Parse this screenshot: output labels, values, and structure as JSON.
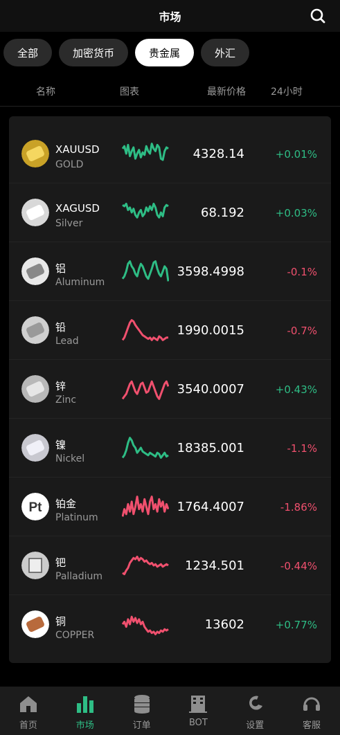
{
  "header": {
    "title": "市场"
  },
  "tabs": [
    {
      "label": "全部",
      "active": false
    },
    {
      "label": "加密货币",
      "active": false
    },
    {
      "label": "贵金属",
      "active": true
    },
    {
      "label": "外汇",
      "active": false
    }
  ],
  "columns": {
    "name": "名称",
    "chart": "图表",
    "price": "最新价格",
    "change": "24小时"
  },
  "colors": {
    "up": "#2ebd85",
    "down": "#f0506e",
    "accent": "#2ebd85"
  },
  "rows": [
    {
      "symbol": "XAUUSD",
      "sub": "GOLD",
      "price": "4328.14",
      "change": "+0.01%",
      "dir": "up",
      "icon": "gold-bar-icon",
      "spark": [
        0.7,
        0.8,
        0.5,
        0.85,
        0.4,
        0.6,
        0.75,
        0.3,
        0.5,
        0.65,
        0.35,
        0.55,
        0.45,
        0.8,
        0.6,
        0.5,
        0.9,
        0.7,
        0.6,
        0.85,
        0.75,
        0.3,
        0.25,
        0.6,
        0.75,
        0.7
      ]
    },
    {
      "symbol": "XAGUSD",
      "sub": "Silver",
      "price": "68.192",
      "change": "+0.03%",
      "dir": "up",
      "icon": "silver-bar-icon",
      "spark": [
        0.8,
        0.75,
        0.85,
        0.6,
        0.7,
        0.5,
        0.65,
        0.4,
        0.3,
        0.5,
        0.6,
        0.35,
        0.45,
        0.7,
        0.55,
        0.75,
        0.6,
        0.85,
        0.7,
        0.4,
        0.3,
        0.5,
        0.35,
        0.7,
        0.8,
        0.75
      ]
    },
    {
      "symbol": "铝",
      "sub": "Aluminum",
      "price": "3598.4998",
      "change": "-0.1%",
      "dir": "up",
      "icon": "aluminum-icon",
      "spark": [
        0.2,
        0.3,
        0.5,
        0.8,
        0.9,
        0.7,
        0.6,
        0.4,
        0.3,
        0.6,
        0.8,
        0.7,
        0.5,
        0.3,
        0.2,
        0.4,
        0.6,
        0.85,
        0.9,
        0.6,
        0.4,
        0.3,
        0.5,
        0.7,
        0.6,
        0.1
      ]
    },
    {
      "symbol": "铅",
      "sub": "Lead",
      "price": "1990.0015",
      "change": "-0.7%",
      "dir": "down",
      "icon": "lead-icon",
      "spark": [
        0.1,
        0.2,
        0.4,
        0.6,
        0.8,
        0.9,
        0.85,
        0.7,
        0.6,
        0.5,
        0.4,
        0.3,
        0.25,
        0.2,
        0.15,
        0.2,
        0.1,
        0.2,
        0.15,
        0.1,
        0.25,
        0.2,
        0.1,
        0.15,
        0.2,
        0.2
      ]
    },
    {
      "symbol": "锌",
      "sub": "Zinc",
      "price": "3540.0007",
      "change": "+0.43%",
      "dir": "down",
      "icon": "zinc-icon",
      "spark": [
        0.1,
        0.2,
        0.3,
        0.5,
        0.7,
        0.8,
        0.6,
        0.4,
        0.3,
        0.5,
        0.7,
        0.75,
        0.55,
        0.35,
        0.4,
        0.6,
        0.8,
        0.6,
        0.4,
        0.2,
        0.1,
        0.3,
        0.5,
        0.7,
        0.8,
        0.6
      ]
    },
    {
      "symbol": "镍",
      "sub": "Nickel",
      "price": "18385.001",
      "change": "-1.1%",
      "dir": "up",
      "icon": "nickel-icon",
      "spark": [
        0.1,
        0.2,
        0.4,
        0.7,
        0.9,
        0.8,
        0.6,
        0.5,
        0.3,
        0.4,
        0.5,
        0.35,
        0.3,
        0.25,
        0.2,
        0.3,
        0.25,
        0.2,
        0.15,
        0.3,
        0.25,
        0.1,
        0.2,
        0.3,
        0.15,
        0.2
      ]
    },
    {
      "symbol": "铂金",
      "sub": "Platinum",
      "price": "1764.4007",
      "change": "-1.86%",
      "dir": "down",
      "icon": "platinum-pt-icon",
      "spark": [
        0.1,
        0.4,
        0.2,
        0.6,
        0.3,
        0.7,
        0.2,
        0.5,
        0.9,
        0.4,
        0.6,
        0.3,
        0.8,
        0.5,
        0.2,
        0.7,
        0.9,
        0.4,
        0.6,
        0.3,
        0.8,
        0.5,
        0.7,
        0.3,
        0.6,
        0.4
      ]
    },
    {
      "symbol": "钯",
      "sub": "Palladium",
      "price": "1234.501",
      "change": "-0.44%",
      "dir": "down",
      "icon": "palladium-icon",
      "spark": [
        0.2,
        0.15,
        0.3,
        0.4,
        0.6,
        0.7,
        0.8,
        0.75,
        0.85,
        0.7,
        0.8,
        0.75,
        0.65,
        0.7,
        0.6,
        0.55,
        0.6,
        0.5,
        0.55,
        0.45,
        0.5,
        0.55,
        0.45,
        0.5,
        0.55,
        0.5
      ]
    },
    {
      "symbol": "铜",
      "sub": "COPPER",
      "price": "13602",
      "change": "+0.77%",
      "dir": "down",
      "icon": "copper-icon",
      "spark": [
        0.5,
        0.6,
        0.4,
        0.7,
        0.5,
        0.8,
        0.6,
        0.75,
        0.55,
        0.7,
        0.5,
        0.6,
        0.4,
        0.3,
        0.2,
        0.25,
        0.15,
        0.2,
        0.1,
        0.2,
        0.15,
        0.25,
        0.2,
        0.3,
        0.25,
        0.3
      ]
    }
  ],
  "nav": [
    {
      "label": "首页",
      "icon": "home-icon",
      "active": false
    },
    {
      "label": "市场",
      "icon": "market-bars-icon",
      "active": true
    },
    {
      "label": "订单",
      "icon": "coins-stack-icon",
      "active": false
    },
    {
      "label": "BOT",
      "icon": "bot-building-icon",
      "active": false
    },
    {
      "label": "设置",
      "icon": "settings-icon",
      "active": false
    },
    {
      "label": "客服",
      "icon": "support-headset-icon",
      "active": false
    }
  ]
}
